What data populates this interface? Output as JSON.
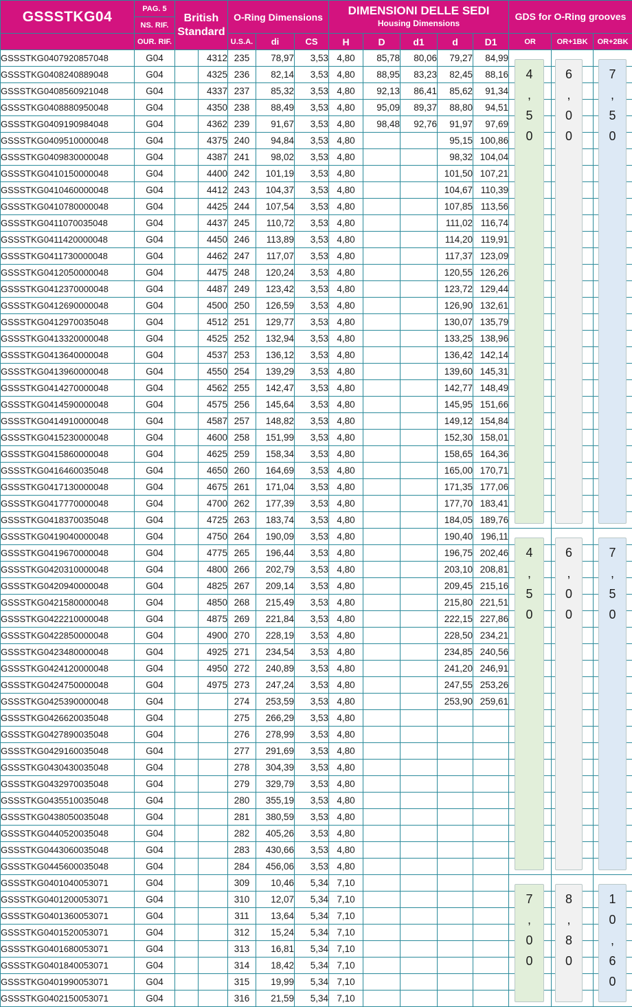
{
  "header": {
    "title": "GSSSTKG04",
    "page_ref": "PAG. 5",
    "ns_rif": "NS. RIF.",
    "our_rif": "OUR. RIF.",
    "british": "British Standard",
    "oring_dim": "O-Ring Dimensions",
    "dimensioni": "DIMENSIONI DELLE SEDI",
    "housing": "Housing Dimensions",
    "gds": "GDS for O-Ring grooves",
    "col_usa": "U.S.A.",
    "col_di": "di",
    "col_cs": "CS",
    "col_H": "H",
    "col_D": "D",
    "col_d1": "d1",
    "col_d": "d",
    "col_D1": "D1",
    "col_or": "OR",
    "col_or1bk": "OR+1BK",
    "col_or2bk": "OR+2BK"
  },
  "rows": [
    [
      "GSSSTKG0407920857048",
      "G04",
      "4312",
      "235",
      "78,97",
      "3,53",
      "4,80",
      "85,78",
      "80,06",
      "79,27",
      "84,99"
    ],
    [
      "GSSSTKG0408240889048",
      "G04",
      "4325",
      "236",
      "82,14",
      "3,53",
      "4,80",
      "88,95",
      "83,23",
      "82,45",
      "88,16"
    ],
    [
      "GSSSTKG0408560921048",
      "G04",
      "4337",
      "237",
      "85,32",
      "3,53",
      "4,80",
      "92,13",
      "86,41",
      "85,62",
      "91,34"
    ],
    [
      "GSSSTKG0408880950048",
      "G04",
      "4350",
      "238",
      "88,49",
      "3,53",
      "4,80",
      "95,09",
      "89,37",
      "88,80",
      "94,51"
    ],
    [
      "GSSSTKG0409190984048",
      "G04",
      "4362",
      "239",
      "91,67",
      "3,53",
      "4,80",
      "98,48",
      "92,76",
      "91,97",
      "97,69"
    ],
    [
      "GSSSTKG0409510000048",
      "G04",
      "4375",
      "240",
      "94,84",
      "3,53",
      "4,80",
      "",
      "",
      "95,15",
      "100,86"
    ],
    [
      "GSSSTKG0409830000048",
      "G04",
      "4387",
      "241",
      "98,02",
      "3,53",
      "4,80",
      "",
      "",
      "98,32",
      "104,04"
    ],
    [
      "GSSSTKG0410150000048",
      "G04",
      "4400",
      "242",
      "101,19",
      "3,53",
      "4,80",
      "",
      "",
      "101,50",
      "107,21"
    ],
    [
      "GSSSTKG0410460000048",
      "G04",
      "4412",
      "243",
      "104,37",
      "3,53",
      "4,80",
      "",
      "",
      "104,67",
      "110,39"
    ],
    [
      "GSSSTKG0410780000048",
      "G04",
      "4425",
      "244",
      "107,54",
      "3,53",
      "4,80",
      "",
      "",
      "107,85",
      "113,56"
    ],
    [
      "GSSSTKG0411070035048",
      "G04",
      "4437",
      "245",
      "110,72",
      "3,53",
      "4,80",
      "",
      "",
      "111,02",
      "116,74"
    ],
    [
      "GSSSTKG0411420000048",
      "G04",
      "4450",
      "246",
      "113,89",
      "3,53",
      "4,80",
      "",
      "",
      "114,20",
      "119,91"
    ],
    [
      "GSSSTKG0411730000048",
      "G04",
      "4462",
      "247",
      "117,07",
      "3,53",
      "4,80",
      "",
      "",
      "117,37",
      "123,09"
    ],
    [
      "GSSSTKG0412050000048",
      "G04",
      "4475",
      "248",
      "120,24",
      "3,53",
      "4,80",
      "",
      "",
      "120,55",
      "126,26"
    ],
    [
      "GSSSTKG0412370000048",
      "G04",
      "4487",
      "249",
      "123,42",
      "3,53",
      "4,80",
      "",
      "",
      "123,72",
      "129,44"
    ],
    [
      "GSSSTKG0412690000048",
      "G04",
      "4500",
      "250",
      "126,59",
      "3,53",
      "4,80",
      "",
      "",
      "126,90",
      "132,61"
    ],
    [
      "GSSSTKG0412970035048",
      "G04",
      "4512",
      "251",
      "129,77",
      "3,53",
      "4,80",
      "",
      "",
      "130,07",
      "135,79"
    ],
    [
      "GSSSTKG0413320000048",
      "G04",
      "4525",
      "252",
      "132,94",
      "3,53",
      "4,80",
      "",
      "",
      "133,25",
      "138,96"
    ],
    [
      "GSSSTKG0413640000048",
      "G04",
      "4537",
      "253",
      "136,12",
      "3,53",
      "4,80",
      "",
      "",
      "136,42",
      "142,14"
    ],
    [
      "GSSSTKG0413960000048",
      "G04",
      "4550",
      "254",
      "139,29",
      "3,53",
      "4,80",
      "",
      "",
      "139,60",
      "145,31"
    ],
    [
      "GSSSTKG0414270000048",
      "G04",
      "4562",
      "255",
      "142,47",
      "3,53",
      "4,80",
      "",
      "",
      "142,77",
      "148,49"
    ],
    [
      "GSSSTKG0414590000048",
      "G04",
      "4575",
      "256",
      "145,64",
      "3,53",
      "4,80",
      "",
      "",
      "145,95",
      "151,66"
    ],
    [
      "GSSSTKG0414910000048",
      "G04",
      "4587",
      "257",
      "148,82",
      "3,53",
      "4,80",
      "",
      "",
      "149,12",
      "154,84"
    ],
    [
      "GSSSTKG0415230000048",
      "G04",
      "4600",
      "258",
      "151,99",
      "3,53",
      "4,80",
      "",
      "",
      "152,30",
      "158,01"
    ],
    [
      "GSSSTKG0415860000048",
      "G04",
      "4625",
      "259",
      "158,34",
      "3,53",
      "4,80",
      "",
      "",
      "158,65",
      "164,36"
    ],
    [
      "GSSSTKG0416460035048",
      "G04",
      "4650",
      "260",
      "164,69",
      "3,53",
      "4,80",
      "",
      "",
      "165,00",
      "170,71"
    ],
    [
      "GSSSTKG0417130000048",
      "G04",
      "4675",
      "261",
      "171,04",
      "3,53",
      "4,80",
      "",
      "",
      "171,35",
      "177,06"
    ],
    [
      "GSSSTKG0417770000048",
      "G04",
      "4700",
      "262",
      "177,39",
      "3,53",
      "4,80",
      "",
      "",
      "177,70",
      "183,41"
    ],
    [
      "GSSSTKG0418370035048",
      "G04",
      "4725",
      "263",
      "183,74",
      "3,53",
      "4,80",
      "",
      "",
      "184,05",
      "189,76"
    ],
    [
      "GSSSTKG0419040000048",
      "G04",
      "4750",
      "264",
      "190,09",
      "3,53",
      "4,80",
      "",
      "",
      "190,40",
      "196,11"
    ],
    [
      "GSSSTKG0419670000048",
      "G04",
      "4775",
      "265",
      "196,44",
      "3,53",
      "4,80",
      "",
      "",
      "196,75",
      "202,46"
    ],
    [
      "GSSSTKG0420310000048",
      "G04",
      "4800",
      "266",
      "202,79",
      "3,53",
      "4,80",
      "",
      "",
      "203,10",
      "208,81"
    ],
    [
      "GSSSTKG0420940000048",
      "G04",
      "4825",
      "267",
      "209,14",
      "3,53",
      "4,80",
      "",
      "",
      "209,45",
      "215,16"
    ],
    [
      "GSSSTKG0421580000048",
      "G04",
      "4850",
      "268",
      "215,49",
      "3,53",
      "4,80",
      "",
      "",
      "215,80",
      "221,51"
    ],
    [
      "GSSSTKG0422210000048",
      "G04",
      "4875",
      "269",
      "221,84",
      "3,53",
      "4,80",
      "",
      "",
      "222,15",
      "227,86"
    ],
    [
      "GSSSTKG0422850000048",
      "G04",
      "4900",
      "270",
      "228,19",
      "3,53",
      "4,80",
      "",
      "",
      "228,50",
      "234,21"
    ],
    [
      "GSSSTKG0423480000048",
      "G04",
      "4925",
      "271",
      "234,54",
      "3,53",
      "4,80",
      "",
      "",
      "234,85",
      "240,56"
    ],
    [
      "GSSSTKG0424120000048",
      "G04",
      "4950",
      "272",
      "240,89",
      "3,53",
      "4,80",
      "",
      "",
      "241,20",
      "246,91"
    ],
    [
      "GSSSTKG0424750000048",
      "G04",
      "4975",
      "273",
      "247,24",
      "3,53",
      "4,80",
      "",
      "",
      "247,55",
      "253,26"
    ],
    [
      "GSSSTKG0425390000048",
      "G04",
      "",
      "274",
      "253,59",
      "3,53",
      "4,80",
      "",
      "",
      "253,90",
      "259,61"
    ],
    [
      "GSSSTKG0426620035048",
      "G04",
      "",
      "275",
      "266,29",
      "3,53",
      "4,80",
      "",
      "",
      "",
      ""
    ],
    [
      "GSSSTKG0427890035048",
      "G04",
      "",
      "276",
      "278,99",
      "3,53",
      "4,80",
      "",
      "",
      "",
      ""
    ],
    [
      "GSSSTKG0429160035048",
      "G04",
      "",
      "277",
      "291,69",
      "3,53",
      "4,80",
      "",
      "",
      "",
      ""
    ],
    [
      "GSSSTKG0430430035048",
      "G04",
      "",
      "278",
      "304,39",
      "3,53",
      "4,80",
      "",
      "",
      "",
      ""
    ],
    [
      "GSSSTKG0432970035048",
      "G04",
      "",
      "279",
      "329,79",
      "3,53",
      "4,80",
      "",
      "",
      "",
      ""
    ],
    [
      "GSSSTKG0435510035048",
      "G04",
      "",
      "280",
      "355,19",
      "3,53",
      "4,80",
      "",
      "",
      "",
      ""
    ],
    [
      "GSSSTKG0438050035048",
      "G04",
      "",
      "281",
      "380,59",
      "3,53",
      "4,80",
      "",
      "",
      "",
      ""
    ],
    [
      "GSSSTKG0440520035048",
      "G04",
      "",
      "282",
      "405,26",
      "3,53",
      "4,80",
      "",
      "",
      "",
      ""
    ],
    [
      "GSSSTKG0443060035048",
      "G04",
      "",
      "283",
      "430,66",
      "3,53",
      "4,80",
      "",
      "",
      "",
      ""
    ],
    [
      "GSSSTKG0445600035048",
      "G04",
      "",
      "284",
      "456,06",
      "3,53",
      "4,80",
      "",
      "",
      "",
      ""
    ],
    [
      "GSSSTKG0401040053071",
      "G04",
      "",
      "309",
      "10,46",
      "5,34",
      "7,10",
      "",
      "",
      "",
      ""
    ],
    [
      "GSSSTKG0401200053071",
      "G04",
      "",
      "310",
      "12,07",
      "5,34",
      "7,10",
      "",
      "",
      "",
      ""
    ],
    [
      "GSSSTKG0401360053071",
      "G04",
      "",
      "311",
      "13,64",
      "5,34",
      "7,10",
      "",
      "",
      "",
      ""
    ],
    [
      "GSSSTKG0401520053071",
      "G04",
      "",
      "312",
      "15,24",
      "5,34",
      "7,10",
      "",
      "",
      "",
      ""
    ],
    [
      "GSSSTKG0401680053071",
      "G04",
      "",
      "313",
      "16,81",
      "5,34",
      "7,10",
      "",
      "",
      "",
      ""
    ],
    [
      "GSSSTKG0401840053071",
      "G04",
      "",
      "314",
      "18,42",
      "5,34",
      "7,10",
      "",
      "",
      "",
      ""
    ],
    [
      "GSSSTKG0401990053071",
      "G04",
      "",
      "315",
      "19,99",
      "5,34",
      "7,10",
      "",
      "",
      "",
      ""
    ],
    [
      "GSSSTKG0402150053071",
      "G04",
      "",
      "316",
      "21,59",
      "5,34",
      "7,10",
      "",
      "",
      "",
      ""
    ]
  ],
  "gds_groups": [
    {
      "or": "4,50",
      "or1bk": "6,00",
      "or2bk": "7,50"
    },
    {
      "or": "4,50",
      "or1bk": "6,00",
      "or2bk": "7,50"
    },
    {
      "or": "7,00",
      "or1bk": "8,80",
      "or2bk": "10,60"
    }
  ],
  "colors": {
    "header_bg": "#d3137f",
    "grid": "#2a8a9a",
    "gds_or": "#e2efda",
    "gds_1bk": "#f1f1f1",
    "gds_2bk": "#dde9f5"
  }
}
